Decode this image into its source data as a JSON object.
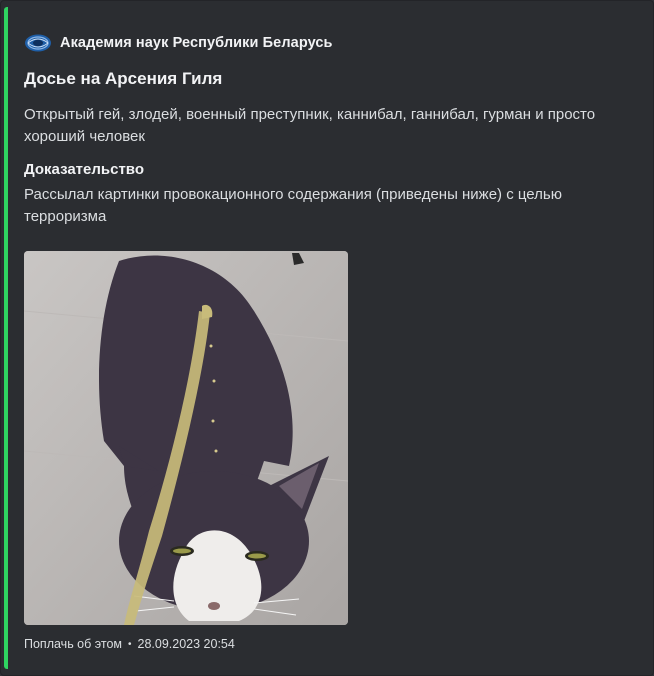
{
  "colors": {
    "accent_bar": "#2fd461",
    "embed_bg": "#2b2d31",
    "text_primary": "#f2f3f5",
    "text_secondary": "#dbdee1"
  },
  "embed": {
    "author": {
      "icon": "academy-emblem-icon",
      "name": "Академия наук Республики Беларусь"
    },
    "title": "Досье на Арсения Гиля",
    "description": "Открытый гей, злодей, военный преступник, каннибал, ганнибал, гурман и просто хороший человек",
    "field": {
      "name": "Доказательство",
      "value": "Рассылал картинки провокационного содержания (приведены ниже) с целью терроризма"
    },
    "image": {
      "icon": "cat-photo"
    },
    "footer": {
      "text": "Поплачь об этом",
      "separator": "•",
      "timestamp": "28.09.2023 20:54"
    }
  }
}
